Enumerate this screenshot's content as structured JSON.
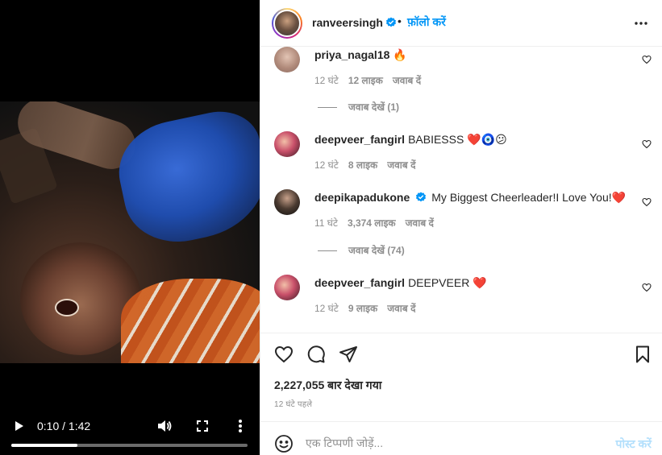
{
  "video": {
    "time_display": "0:10 / 1:42",
    "progress_fraction": 0.28
  },
  "post": {
    "username": "ranveersingh",
    "separator": "•",
    "follow_label": "फ़ॉलो करें"
  },
  "comments": [
    {
      "username": "priya_nagal18",
      "text": "🔥",
      "time": "12 घंटे",
      "likes": "12 लाइक",
      "reply_label": "जवाब दें",
      "view_replies": "जवाब देखें (1)"
    },
    {
      "username": "deepveer_fangirl",
      "text": "BABIESSS ❤️🧿😕",
      "time": "12 घंटे",
      "likes": "8 लाइक",
      "reply_label": "जवाब दें"
    },
    {
      "username": "deepikapadukone",
      "verified": true,
      "text": "My Biggest Cheerleader!I Love You!❤️",
      "time": "11 घंटे",
      "likes": "3,374 लाइक",
      "reply_label": "जवाब दें",
      "view_replies": "जवाब देखें (74)"
    },
    {
      "username": "deepveer_fangirl",
      "text": "DEEPVEER ❤️",
      "time": "12 घंटे",
      "likes": "9 लाइक",
      "reply_label": "जवाब दें"
    }
  ],
  "stats": {
    "views": "2,227,055 बार देखा गया",
    "time_ago": "12 घंटे पहले"
  },
  "comment_box": {
    "placeholder": "एक टिप्पणी जोड़ें...",
    "post_label": "पोस्ट करें"
  },
  "colors": {
    "accent": "#0095f6",
    "post_disabled": "#b2dffc",
    "heart": "#ed4956"
  },
  "icons": {
    "video": [
      "play-icon",
      "volume-icon",
      "fullscreen-icon",
      "more-vertical-icon"
    ],
    "actions": [
      "heart-icon",
      "comment-icon",
      "share-icon",
      "bookmark-icon"
    ]
  }
}
